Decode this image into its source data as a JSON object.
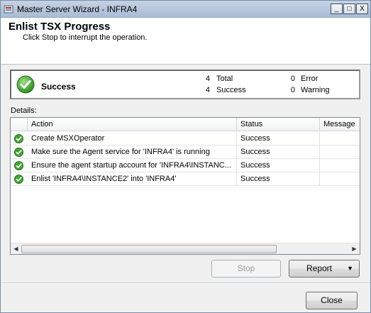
{
  "window": {
    "title": "Master Server Wizard - INFRA4",
    "minimize_label": "_",
    "maximize_label": "□",
    "close_label": "X"
  },
  "header": {
    "title": "Enlist TSX Progress",
    "subtitle": "Click Stop to interrupt the operation."
  },
  "summary": {
    "status": "Success",
    "total_count": "4",
    "total_label": "Total",
    "success_count": "4",
    "success_label": "Success",
    "error_count": "0",
    "error_label": "Error",
    "warning_count": "0",
    "warning_label": "Warning"
  },
  "details": {
    "label": "Details:",
    "columns": [
      "Action",
      "Status",
      "Message"
    ],
    "rows": [
      {
        "action": "Create MSXOperator",
        "status": "Success",
        "message": ""
      },
      {
        "action": "Make sure the Agent service for 'INFRA4' is running",
        "status": "Success",
        "message": ""
      },
      {
        "action": "Ensure the agent startup account for 'INFRA4\\INSTANC...",
        "status": "Success",
        "message": ""
      },
      {
        "action": "Enlist 'INFRA4\\INSTANCE2' into 'INFRA4'",
        "status": "Success",
        "message": ""
      }
    ]
  },
  "buttons": {
    "stop": "Stop",
    "report": "Report",
    "close": "Close"
  },
  "colors": {
    "success_green": "#3da82e",
    "titlebar": "#b9c9dd"
  }
}
